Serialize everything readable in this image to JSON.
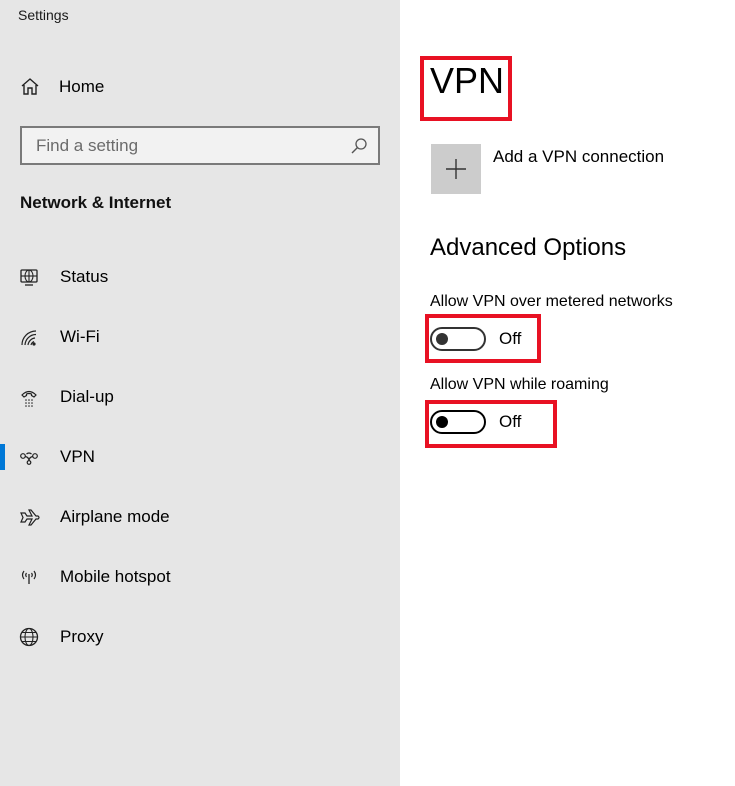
{
  "window": {
    "title": "Settings"
  },
  "sidebar": {
    "home": {
      "label": "Home",
      "icon": "home-icon"
    },
    "search": {
      "placeholder": "Find a setting",
      "value": "",
      "icon": "search-icon"
    },
    "section_title": "Network & Internet",
    "items": [
      {
        "label": "Status",
        "icon": "globe-monitor-icon",
        "selected": false
      },
      {
        "label": "Wi-Fi",
        "icon": "wifi-icon",
        "selected": false
      },
      {
        "label": "Dial-up",
        "icon": "phone-icon",
        "selected": false
      },
      {
        "label": "VPN",
        "icon": "vpn-icon",
        "selected": true
      },
      {
        "label": "Airplane mode",
        "icon": "airplane-icon",
        "selected": false
      },
      {
        "label": "Mobile hotspot",
        "icon": "hotspot-icon",
        "selected": false
      },
      {
        "label": "Proxy",
        "icon": "globe-icon",
        "selected": false
      }
    ],
    "accent_color": "#0078d7"
  },
  "main": {
    "title": "VPN",
    "add_connection": {
      "label": "Add a VPN connection",
      "icon": "plus-icon"
    },
    "advanced_title": "Advanced Options",
    "options": [
      {
        "label": "Allow VPN over metered networks",
        "state": "Off",
        "on": false
      },
      {
        "label": "Allow VPN while roaming",
        "state": "Off",
        "on": false
      }
    ],
    "highlight_color": "#e81123"
  }
}
